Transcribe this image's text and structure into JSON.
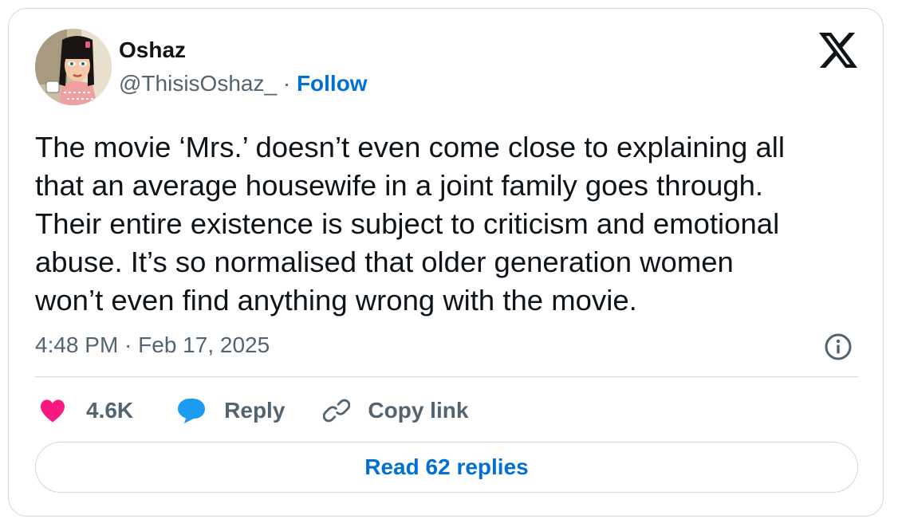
{
  "author": {
    "name": "Oshaz",
    "handle": "@ThisisOshaz_",
    "separator": " · ",
    "follow_label": "Follow",
    "avatar": "cartoon-woman-avatar"
  },
  "platform_logo": "x-logo-icon",
  "tweet": {
    "text": "The movie ‘Mrs.’ doesn’t even come close to explaining all\nthat an average housewife in a joint family goes through.\nTheir entire existence is subject to criticism and emotional\nabuse. It’s so normalised that older generation women\nwon’t even find anything wrong with the movie.",
    "timestamp": "4:48 PM · Feb 17, 2025"
  },
  "actions": {
    "like_count": "4.6K",
    "reply_label": "Reply",
    "copy_link_label": "Copy link"
  },
  "read_replies_label": "Read 62 replies",
  "colors": {
    "accent": "#006fd6",
    "like": "#f91880",
    "reply_bubble": "#1d9bf0",
    "text_primary": "#0f1419",
    "text_secondary": "#536471",
    "border": "#cfd9de"
  }
}
